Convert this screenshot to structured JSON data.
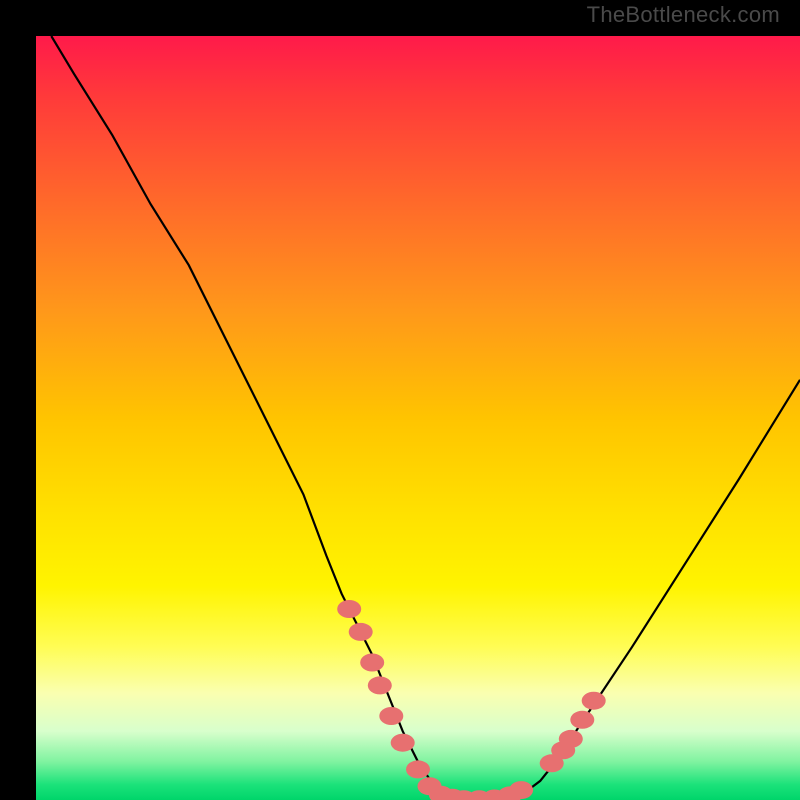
{
  "watermark": "TheBottleneck.com",
  "colors": {
    "frame": "#000000",
    "curve_stroke": "#000000",
    "marker_fill": "#e77070",
    "gradient_top": "#ff1a4a",
    "gradient_bottom": "#00d56a"
  },
  "chart_data": {
    "type": "line",
    "title": "",
    "xlabel": "",
    "ylabel": "",
    "xlim": [
      0,
      100
    ],
    "ylim": [
      0,
      100
    ],
    "grid": false,
    "legend": false,
    "annotations": [
      "TheBottleneck.com"
    ],
    "series": [
      {
        "name": "bottleneck-curve",
        "x": [
          2,
          5,
          10,
          15,
          20,
          25,
          30,
          35,
          38,
          40,
          42,
          44,
          46,
          48,
          50,
          52,
          54,
          56,
          58,
          60,
          62,
          64,
          66,
          68,
          72,
          78,
          85,
          92,
          100
        ],
        "y": [
          100,
          95,
          87,
          78,
          70,
          60,
          50,
          40,
          32,
          27,
          23,
          19,
          14,
          9,
          5,
          2,
          0.5,
          0,
          0,
          0,
          0.5,
          1,
          2.5,
          5,
          11,
          20,
          31,
          42,
          55
        ]
      }
    ],
    "markers": [
      {
        "x": 41,
        "y": 25
      },
      {
        "x": 42.5,
        "y": 22
      },
      {
        "x": 44,
        "y": 18
      },
      {
        "x": 45,
        "y": 15
      },
      {
        "x": 46.5,
        "y": 11
      },
      {
        "x": 48,
        "y": 7.5
      },
      {
        "x": 50,
        "y": 4
      },
      {
        "x": 51.5,
        "y": 1.8
      },
      {
        "x": 53,
        "y": 0.7
      },
      {
        "x": 54.5,
        "y": 0.3
      },
      {
        "x": 56,
        "y": 0.1
      },
      {
        "x": 58,
        "y": 0.1
      },
      {
        "x": 60,
        "y": 0.2
      },
      {
        "x": 62,
        "y": 0.6
      },
      {
        "x": 63.5,
        "y": 1.3
      },
      {
        "x": 67.5,
        "y": 4.8
      },
      {
        "x": 69,
        "y": 6.5
      },
      {
        "x": 70,
        "y": 8
      },
      {
        "x": 71.5,
        "y": 10.5
      },
      {
        "x": 73,
        "y": 13
      }
    ]
  }
}
